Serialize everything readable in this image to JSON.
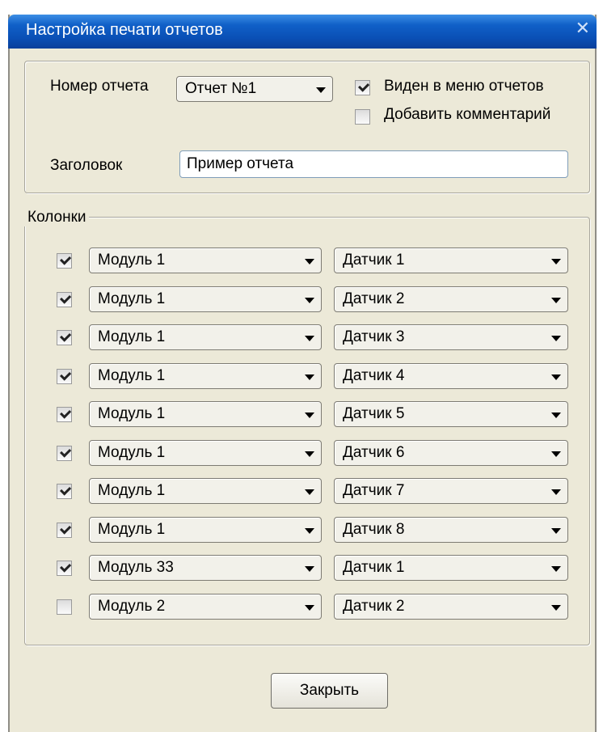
{
  "window": {
    "title": "Настройка печати отчетов",
    "close_glyph": "✕"
  },
  "report": {
    "number_label": "Номер отчета",
    "number_value": "Отчет №1",
    "visible_in_menu_label": "Виден в меню отчетов",
    "visible_in_menu_checked": true,
    "add_comment_label": "Добавить комментарий",
    "add_comment_checked": false,
    "heading_label": "Заголовок",
    "heading_value": "Пример отчета"
  },
  "columns": {
    "group_label": "Колонки",
    "rows": [
      {
        "checked": true,
        "module": "Модуль 1",
        "sensor": "Датчик 1"
      },
      {
        "checked": true,
        "module": "Модуль 1",
        "sensor": "Датчик 2"
      },
      {
        "checked": true,
        "module": "Модуль 1",
        "sensor": "Датчик 3"
      },
      {
        "checked": true,
        "module": "Модуль 1",
        "sensor": "Датчик 4"
      },
      {
        "checked": true,
        "module": "Модуль 1",
        "sensor": "Датчик 5"
      },
      {
        "checked": true,
        "module": "Модуль 1",
        "sensor": "Датчик 6"
      },
      {
        "checked": true,
        "module": "Модуль 1",
        "sensor": "Датчик 7"
      },
      {
        "checked": true,
        "module": "Модуль 1",
        "sensor": "Датчик 8"
      },
      {
        "checked": true,
        "module": "Модуль 33",
        "sensor": "Датчик 1"
      },
      {
        "checked": false,
        "module": "Модуль 2",
        "sensor": "Датчик 2"
      }
    ]
  },
  "footer": {
    "close_button_label": "Закрыть"
  },
  "colors": {
    "titlebar": "#0a4fb5",
    "window_bg": "#ece9d8"
  }
}
